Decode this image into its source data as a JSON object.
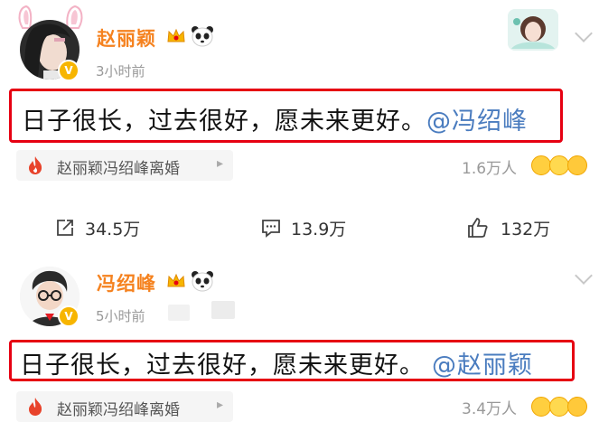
{
  "posts": [
    {
      "author": "赵丽颖",
      "time": "3小时前",
      "text": "日子很长，过去很好，愿未来更好。",
      "mention": "@冯绍峰",
      "topic": "赵丽颖冯绍峰离婚",
      "topic_arrow": "▸",
      "people_count": "1.6万人",
      "actions": {
        "repost": "34.5万",
        "comment": "13.9万",
        "like": "132万"
      }
    },
    {
      "author": "冯绍峰",
      "time": "5小时前",
      "text": "日子很长，过去很好，愿未来更好。",
      "mention": "@赵丽颖",
      "topic": "赵丽颖冯绍峰离婚",
      "topic_arrow": "▸",
      "people_count": "3.4万人"
    }
  ],
  "colors": {
    "author_name": "#f5821f",
    "mention": "#4a7cbf",
    "highlight_border": "#e60012",
    "topic_fire": "#e8432b",
    "verified_badge": "#f7b500"
  },
  "icons": [
    "crown-icon",
    "panda-icon",
    "verified-icon",
    "chevron-down-icon",
    "fire-icon",
    "share-icon",
    "comment-icon",
    "like-icon",
    "reaction-emoji-icon"
  ]
}
